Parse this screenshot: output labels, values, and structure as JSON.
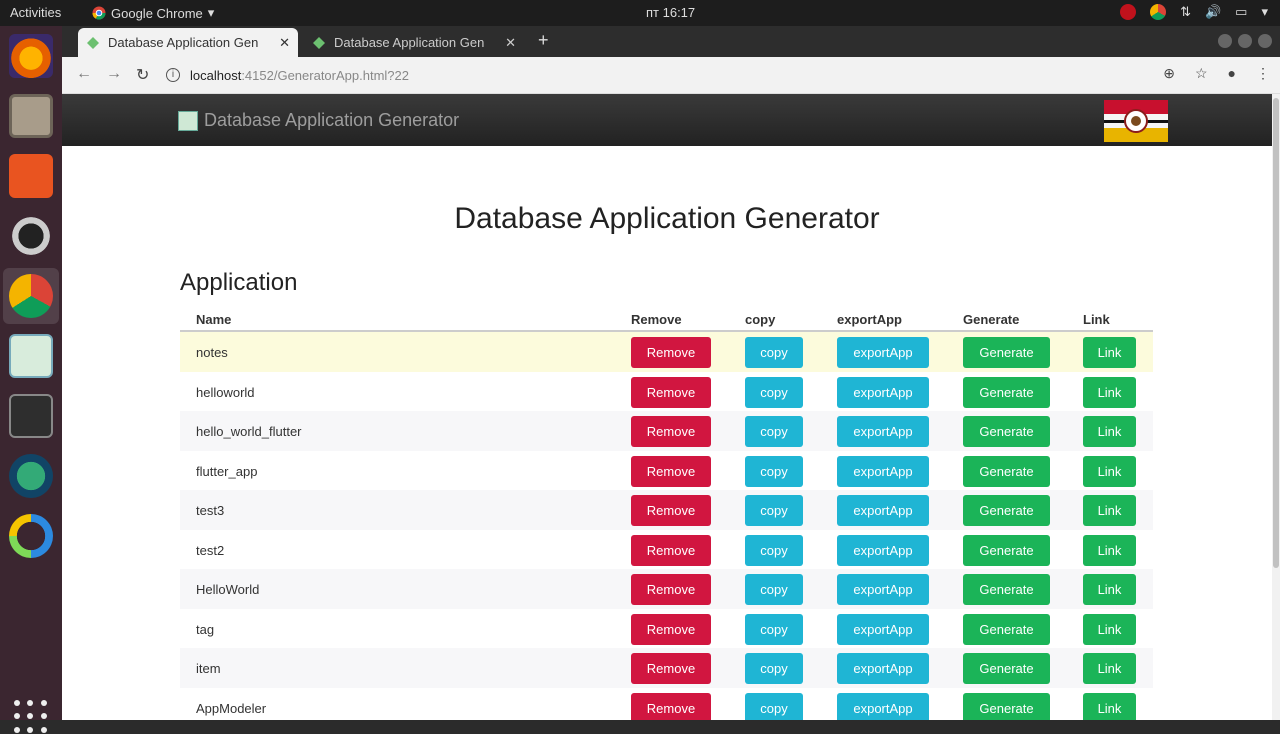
{
  "os": {
    "activities": "Activities",
    "app_menu": "Google Chrome",
    "clock": "пт 16:17"
  },
  "browser": {
    "tabs": [
      {
        "title": "Database Application Gen"
      },
      {
        "title": "Database Application Gen"
      }
    ],
    "url_host": "localhost",
    "url_path": ":4152/GeneratorApp.html?22"
  },
  "navbar": {
    "brand": "Database Application Generator"
  },
  "page": {
    "title": "Database Application Generator",
    "section": "Application"
  },
  "table": {
    "headers": {
      "name": "Name",
      "remove": "Remove",
      "copy": "copy",
      "export": "exportApp",
      "generate": "Generate",
      "link": "Link"
    },
    "rows": [
      {
        "name": "notes"
      },
      {
        "name": "helloworld"
      },
      {
        "name": "hello_world_flutter"
      },
      {
        "name": "flutter_app"
      },
      {
        "name": "test3"
      },
      {
        "name": "test2"
      },
      {
        "name": "HelloWorld"
      },
      {
        "name": "tag"
      },
      {
        "name": "item"
      },
      {
        "name": "AppModeler"
      }
    ],
    "buttons": {
      "remove": "Remove",
      "copy": "copy",
      "export": "exportApp",
      "generate": "Generate",
      "link": "Link"
    }
  },
  "colors": {
    "remove": "#d11640",
    "info": "#1fb5d4",
    "success": "#1bb458",
    "navbar": "#222222"
  }
}
